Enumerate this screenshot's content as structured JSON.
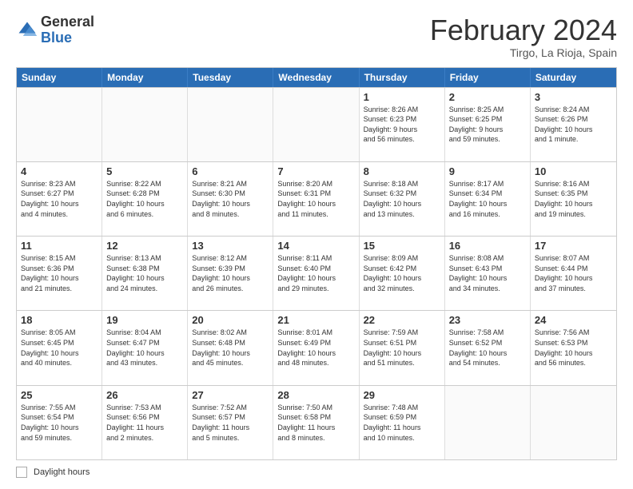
{
  "logo": {
    "general": "General",
    "blue": "Blue"
  },
  "title": "February 2024",
  "subtitle": "Tirgo, La Rioja, Spain",
  "days_of_week": [
    "Sunday",
    "Monday",
    "Tuesday",
    "Wednesday",
    "Thursday",
    "Friday",
    "Saturday"
  ],
  "footer_label": "Daylight hours",
  "weeks": [
    [
      {
        "day": "",
        "info": ""
      },
      {
        "day": "",
        "info": ""
      },
      {
        "day": "",
        "info": ""
      },
      {
        "day": "",
        "info": ""
      },
      {
        "day": "1",
        "info": "Sunrise: 8:26 AM\nSunset: 6:23 PM\nDaylight: 9 hours\nand 56 minutes."
      },
      {
        "day": "2",
        "info": "Sunrise: 8:25 AM\nSunset: 6:25 PM\nDaylight: 9 hours\nand 59 minutes."
      },
      {
        "day": "3",
        "info": "Sunrise: 8:24 AM\nSunset: 6:26 PM\nDaylight: 10 hours\nand 1 minute."
      }
    ],
    [
      {
        "day": "4",
        "info": "Sunrise: 8:23 AM\nSunset: 6:27 PM\nDaylight: 10 hours\nand 4 minutes."
      },
      {
        "day": "5",
        "info": "Sunrise: 8:22 AM\nSunset: 6:28 PM\nDaylight: 10 hours\nand 6 minutes."
      },
      {
        "day": "6",
        "info": "Sunrise: 8:21 AM\nSunset: 6:30 PM\nDaylight: 10 hours\nand 8 minutes."
      },
      {
        "day": "7",
        "info": "Sunrise: 8:20 AM\nSunset: 6:31 PM\nDaylight: 10 hours\nand 11 minutes."
      },
      {
        "day": "8",
        "info": "Sunrise: 8:18 AM\nSunset: 6:32 PM\nDaylight: 10 hours\nand 13 minutes."
      },
      {
        "day": "9",
        "info": "Sunrise: 8:17 AM\nSunset: 6:34 PM\nDaylight: 10 hours\nand 16 minutes."
      },
      {
        "day": "10",
        "info": "Sunrise: 8:16 AM\nSunset: 6:35 PM\nDaylight: 10 hours\nand 19 minutes."
      }
    ],
    [
      {
        "day": "11",
        "info": "Sunrise: 8:15 AM\nSunset: 6:36 PM\nDaylight: 10 hours\nand 21 minutes."
      },
      {
        "day": "12",
        "info": "Sunrise: 8:13 AM\nSunset: 6:38 PM\nDaylight: 10 hours\nand 24 minutes."
      },
      {
        "day": "13",
        "info": "Sunrise: 8:12 AM\nSunset: 6:39 PM\nDaylight: 10 hours\nand 26 minutes."
      },
      {
        "day": "14",
        "info": "Sunrise: 8:11 AM\nSunset: 6:40 PM\nDaylight: 10 hours\nand 29 minutes."
      },
      {
        "day": "15",
        "info": "Sunrise: 8:09 AM\nSunset: 6:42 PM\nDaylight: 10 hours\nand 32 minutes."
      },
      {
        "day": "16",
        "info": "Sunrise: 8:08 AM\nSunset: 6:43 PM\nDaylight: 10 hours\nand 34 minutes."
      },
      {
        "day": "17",
        "info": "Sunrise: 8:07 AM\nSunset: 6:44 PM\nDaylight: 10 hours\nand 37 minutes."
      }
    ],
    [
      {
        "day": "18",
        "info": "Sunrise: 8:05 AM\nSunset: 6:45 PM\nDaylight: 10 hours\nand 40 minutes."
      },
      {
        "day": "19",
        "info": "Sunrise: 8:04 AM\nSunset: 6:47 PM\nDaylight: 10 hours\nand 43 minutes."
      },
      {
        "day": "20",
        "info": "Sunrise: 8:02 AM\nSunset: 6:48 PM\nDaylight: 10 hours\nand 45 minutes."
      },
      {
        "day": "21",
        "info": "Sunrise: 8:01 AM\nSunset: 6:49 PM\nDaylight: 10 hours\nand 48 minutes."
      },
      {
        "day": "22",
        "info": "Sunrise: 7:59 AM\nSunset: 6:51 PM\nDaylight: 10 hours\nand 51 minutes."
      },
      {
        "day": "23",
        "info": "Sunrise: 7:58 AM\nSunset: 6:52 PM\nDaylight: 10 hours\nand 54 minutes."
      },
      {
        "day": "24",
        "info": "Sunrise: 7:56 AM\nSunset: 6:53 PM\nDaylight: 10 hours\nand 56 minutes."
      }
    ],
    [
      {
        "day": "25",
        "info": "Sunrise: 7:55 AM\nSunset: 6:54 PM\nDaylight: 10 hours\nand 59 minutes."
      },
      {
        "day": "26",
        "info": "Sunrise: 7:53 AM\nSunset: 6:56 PM\nDaylight: 11 hours\nand 2 minutes."
      },
      {
        "day": "27",
        "info": "Sunrise: 7:52 AM\nSunset: 6:57 PM\nDaylight: 11 hours\nand 5 minutes."
      },
      {
        "day": "28",
        "info": "Sunrise: 7:50 AM\nSunset: 6:58 PM\nDaylight: 11 hours\nand 8 minutes."
      },
      {
        "day": "29",
        "info": "Sunrise: 7:48 AM\nSunset: 6:59 PM\nDaylight: 11 hours\nand 10 minutes."
      },
      {
        "day": "",
        "info": ""
      },
      {
        "day": "",
        "info": ""
      }
    ]
  ]
}
